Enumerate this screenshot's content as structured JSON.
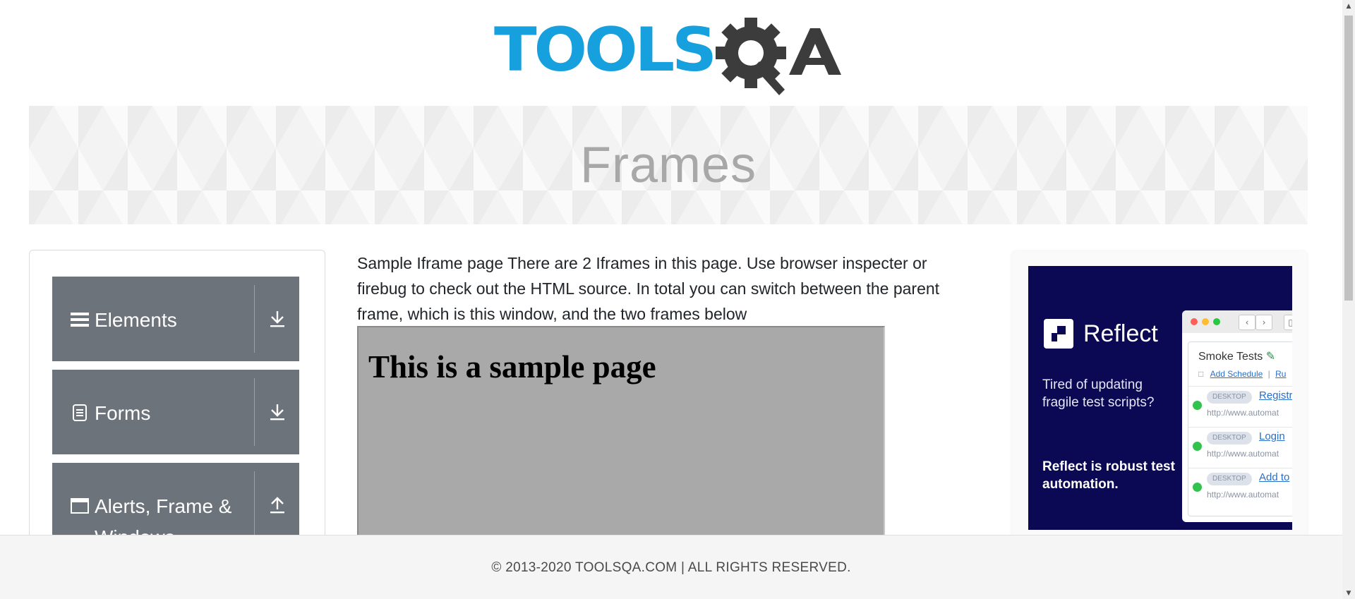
{
  "header": {
    "logo_text": "TOOLSQA"
  },
  "banner": {
    "title": "Frames"
  },
  "sidebar": {
    "groups": [
      {
        "label": "Elements",
        "icon": "menu-icon",
        "toggle_icon": "download-arrow-icon"
      },
      {
        "label": "Forms",
        "icon": "document-icon",
        "toggle_icon": "download-arrow-icon"
      },
      {
        "label": "Alerts, Frame & Windows",
        "icon": "window-icon",
        "toggle_icon": "upload-arrow-icon"
      }
    ]
  },
  "main": {
    "description": "Sample Iframe page There are 2 Iframes in this page. Use browser inspecter or firebug to check out the HTML source. In total you can switch between the parent frame, which is this window, and the two frames below",
    "iframe_heading": "This is a sample page"
  },
  "ad": {
    "brand": "Reflect",
    "tagline": "Tired of updating fragile test scripts?",
    "claim": "Reflect is robust test automation.",
    "window": {
      "suite_title": "Smoke Tests",
      "add_schedule": "Add Schedule",
      "separator": "|",
      "run_link": "Ru",
      "tests": [
        {
          "badge": "DESKTOP",
          "name": "Registr",
          "url": "http://www.automat"
        },
        {
          "badge": "DESKTOP",
          "name": "Login",
          "url": "http://www.automat"
        },
        {
          "badge": "DESKTOP",
          "name": "Add to",
          "url": "http://www.automat"
        }
      ]
    }
  },
  "footer": {
    "text": "© 2013-2020 TOOLSQA.COM | ALL RIGHTS RESERVED."
  },
  "colors": {
    "logo_blue": "#16a0de",
    "logo_dark": "#3c3c3c",
    "sidebar_group_bg": "#6c737b",
    "ad_bg": "#0b0953",
    "iframe_bg": "#a9a9a9"
  }
}
